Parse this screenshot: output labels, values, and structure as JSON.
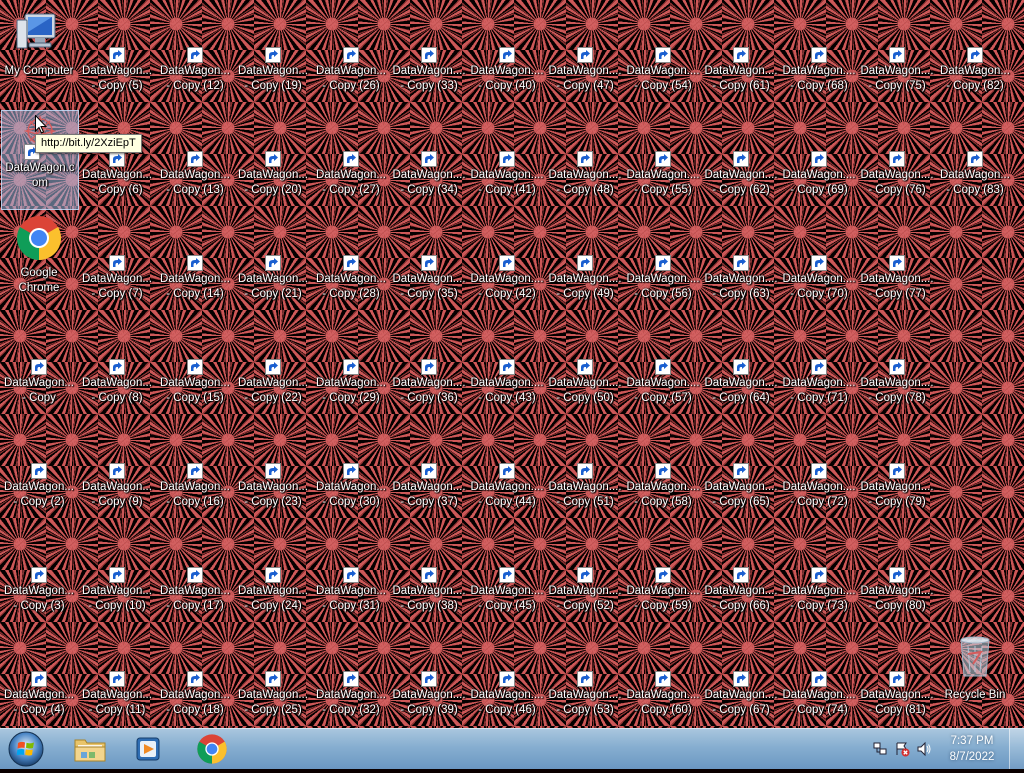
{
  "desktop": {
    "special": {
      "my_computer": "My Computer",
      "datawagon_main": [
        "DataWagon.c",
        "om"
      ],
      "chrome": [
        "Google",
        "Chrome"
      ],
      "recycle_bin": "Recycle Bin"
    },
    "tooltip": "http://bit.ly/2XziEpT",
    "shortcut_prefix": "DataWagon...",
    "copy_labels": [
      "- Copy",
      "- Copy (2)",
      "- Copy (3)",
      "- Copy (4)",
      "- Copy (5)",
      "- Copy (6)",
      "- Copy (7)",
      "- Copy (8)",
      "- Copy (9)",
      "- Copy (10)",
      "- Copy (11)",
      "- Copy (12)",
      "- Copy (13)",
      "- Copy (14)",
      "- Copy (15)",
      "- Copy (16)",
      "- Copy (17)",
      "- Copy (18)",
      "- Copy (19)",
      "- Copy (20)",
      "- Copy (21)",
      "- Copy (22)",
      "- Copy (23)",
      "- Copy (24)",
      "- Copy (25)",
      "- Copy (26)",
      "- Copy (27)",
      "- Copy (28)",
      "- Copy (29)",
      "- Copy (30)",
      "- Copy (31)",
      "- Copy (32)",
      "- Copy (33)",
      "- Copy (34)",
      "- Copy (35)",
      "- Copy (36)",
      "- Copy (37)",
      "- Copy (38)",
      "- Copy (39)",
      "- Copy (40)",
      "- Copy (41)",
      "- Copy (42)",
      "- Copy (43)",
      "- Copy (44)",
      "- Copy (45)",
      "- Copy (46)",
      "- Copy (47)",
      "- Copy (48)",
      "- Copy (49)",
      "- Copy (50)",
      "- Copy (51)",
      "- Copy (52)",
      "- Copy (53)",
      "- Copy (54)",
      "- Copy (55)",
      "- Copy (56)",
      "- Copy (57)",
      "- Copy (58)",
      "- Copy (59)",
      "- Copy (60)",
      "- Copy (61)",
      "- Copy (62)",
      "- Copy (63)",
      "- Copy (64)",
      "- Copy (65)",
      "- Copy (66)",
      "- Copy (67)",
      "- Copy (68)",
      "- Copy (69)",
      "- Copy (70)",
      "- Copy (71)",
      "- Copy (72)",
      "- Copy (73)",
      "- Copy (74)",
      "- Copy (75)",
      "- Copy (76)",
      "- Copy (77)",
      "- Copy (78)",
      "- Copy (79)",
      "- Copy (80)",
      "- Copy (81)",
      "- Copy (82)",
      "- Copy (83)"
    ],
    "copy_prefixes": {
      "1": "DataWagon...",
      "2": "DataWagon...",
      "3": "DataWagon...",
      "4": "DataWagon...",
      "5": "DataWagon....",
      "6": "DataWagon....",
      "7": "DataWagon....",
      "8": "DataWagon....",
      "9": "DataWagon....",
      "10": "DataWagon....",
      "11": "DataWagon...."
    }
  },
  "taskbar": {
    "pinned": [
      "start-orb",
      "explorer-icon",
      "media-player-icon",
      "chrome-icon"
    ],
    "clock": {
      "time": "7:37 PM",
      "date": "8/7/2022"
    },
    "tray_icons": [
      "network-icon",
      "action-center-icon",
      "volume-icon"
    ]
  },
  "colors": {
    "wallpaper_pattern": "#d65c5c",
    "wallpaper_bg": "#050000",
    "taskbar": "#86aed0",
    "selection": "#a0bee6",
    "tooltip_bg": "#ffffe1"
  }
}
